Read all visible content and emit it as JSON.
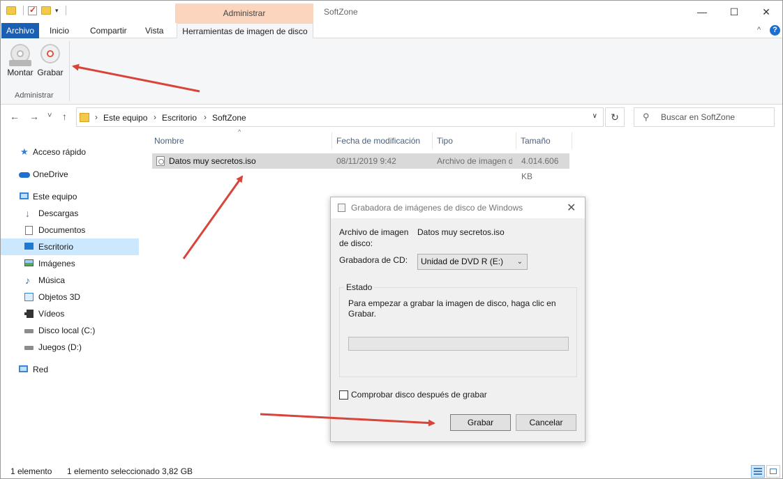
{
  "window": {
    "context_tab_header": "Administrar",
    "title": "SoftZone",
    "controls": {
      "minimize": "—",
      "maximize": "☐",
      "close": "✕"
    }
  },
  "ribbon": {
    "tabs": [
      {
        "label": "Archivo"
      },
      {
        "label": "Inicio"
      },
      {
        "label": "Compartir"
      },
      {
        "label": "Vista"
      },
      {
        "label": "Herramientas de imagen de disco"
      }
    ],
    "collapse_glyph": "^",
    "help_glyph": "?",
    "buttons": {
      "mount": "Montar",
      "burn": "Grabar"
    },
    "group_label": "Administrar"
  },
  "address": {
    "crumbs": [
      "Este equipo",
      "Escritorio",
      "SoftZone"
    ],
    "crumb_separator": "›",
    "search_placeholder": "Buscar en SoftZone",
    "nav_glyphs": {
      "back": "←",
      "forward": "→",
      "recent": "˅",
      "up": "↑",
      "dropdown": "∨",
      "refresh": "↻",
      "search": "⚲"
    }
  },
  "sidebar": {
    "items": [
      {
        "label": "Acceso rápido",
        "icon": "star-icon"
      },
      {
        "label": "OneDrive",
        "icon": "cloud-icon"
      },
      {
        "label": "Este equipo",
        "icon": "computer-icon"
      },
      {
        "label": "Descargas",
        "icon": "download-icon"
      },
      {
        "label": "Documentos",
        "icon": "document-icon"
      },
      {
        "label": "Escritorio",
        "icon": "desktop-icon",
        "selected": true
      },
      {
        "label": "Imágenes",
        "icon": "pictures-icon"
      },
      {
        "label": "Música",
        "icon": "music-icon"
      },
      {
        "label": "Objetos 3D",
        "icon": "3d-objects-icon"
      },
      {
        "label": "Vídeos",
        "icon": "videos-icon"
      },
      {
        "label": "Disco local (C:)",
        "icon": "local-disk-icon"
      },
      {
        "label": "Juegos (D:)",
        "icon": "drive-icon"
      },
      {
        "label": "Red",
        "icon": "network-icon"
      }
    ]
  },
  "filelist": {
    "columns": [
      "Nombre",
      "Fecha de modificación",
      "Tipo",
      "Tamaño"
    ],
    "sort_glyph": "^",
    "rows": [
      {
        "name": "Datos muy secretos.iso",
        "date": "08/11/2019 9:42",
        "type": "Archivo de imagen de disco",
        "size": "4.014.606 KB",
        "selected": true
      }
    ]
  },
  "dialog": {
    "title": "Grabadora de imágenes de disco de Windows",
    "close_glyph": "✕",
    "image_file_label": "Archivo de imagen de disco:",
    "image_file_value": "Datos muy secretos.iso",
    "burner_label": "Grabadora de CD:",
    "burner_value": "Unidad de DVD R (E:)",
    "combo_arrow": "⌄",
    "status_legend": "Estado",
    "status_text": "Para empezar a grabar la imagen de disco, haga clic en Grabar.",
    "progress": 0,
    "verify_label": "Comprobar disco después de grabar",
    "verify_checked": false,
    "burn_button": "Grabar",
    "cancel_button": "Cancelar"
  },
  "statusbar": {
    "item_count": "1 elemento",
    "selected_count": "1 elemento seleccionado",
    "selected_size": "3,82 GB"
  },
  "colors": {
    "file_tab": "#1a5fb4",
    "context_tab": "#fbd5be",
    "selection": "#cce8ff",
    "annotation_arrow": "#d9443a"
  }
}
